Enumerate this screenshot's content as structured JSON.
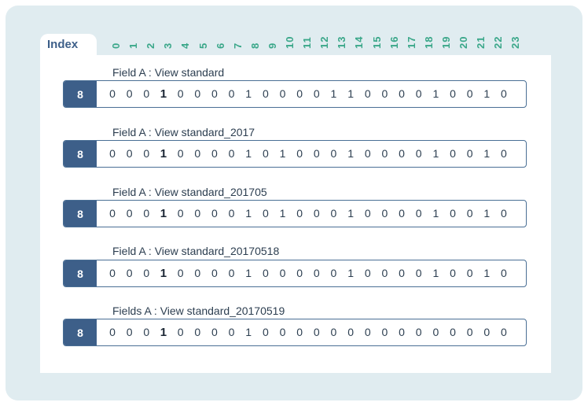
{
  "tab": {
    "label": "Index"
  },
  "columns": [
    "0",
    "1",
    "2",
    "3",
    "4",
    "5",
    "6",
    "7",
    "8",
    "9",
    "10",
    "11",
    "12",
    "13",
    "14",
    "15",
    "16",
    "17",
    "18",
    "19",
    "20",
    "21",
    "22",
    "23"
  ],
  "rows": [
    {
      "title": "Field A : View standard",
      "badge": "8",
      "bits": [
        "0",
        "0",
        "0",
        "1",
        "0",
        "0",
        "0",
        "0",
        "1",
        "0",
        "0",
        "0",
        "0",
        "1",
        "1",
        "0",
        "0",
        "0",
        "0",
        "1",
        "0",
        "0",
        "1",
        "0"
      ]
    },
    {
      "title": "Field A : View standard_2017",
      "badge": "8",
      "bits": [
        "0",
        "0",
        "0",
        "1",
        "0",
        "0",
        "0",
        "0",
        "1",
        "0",
        "1",
        "0",
        "0",
        "0",
        "1",
        "0",
        "0",
        "0",
        "0",
        "1",
        "0",
        "0",
        "1",
        "0"
      ]
    },
    {
      "title": "Field A : View standard_201705",
      "badge": "8",
      "bits": [
        "0",
        "0",
        "0",
        "1",
        "0",
        "0",
        "0",
        "0",
        "1",
        "0",
        "1",
        "0",
        "0",
        "0",
        "1",
        "0",
        "0",
        "0",
        "0",
        "1",
        "0",
        "0",
        "1",
        "0"
      ]
    },
    {
      "title": "Field A : View standard_20170518",
      "badge": "8",
      "bits": [
        "0",
        "0",
        "0",
        "1",
        "0",
        "0",
        "0",
        "0",
        "1",
        "0",
        "0",
        "0",
        "0",
        "0",
        "1",
        "0",
        "0",
        "0",
        "0",
        "1",
        "0",
        "0",
        "1",
        "0"
      ]
    },
    {
      "title": "Fields A : View standard_20170519",
      "badge": "8",
      "bits": [
        "0",
        "0",
        "0",
        "1",
        "0",
        "0",
        "0",
        "0",
        "1",
        "0",
        "0",
        "0",
        "0",
        "0",
        "0",
        "0",
        "0",
        "0",
        "0",
        "0",
        "0",
        "0",
        "0",
        "0"
      ]
    }
  ],
  "highlight_column": 3,
  "colors": {
    "accent": "#3d5f89",
    "index_numbers": "#3aa789",
    "background": "#e0ecf0"
  }
}
